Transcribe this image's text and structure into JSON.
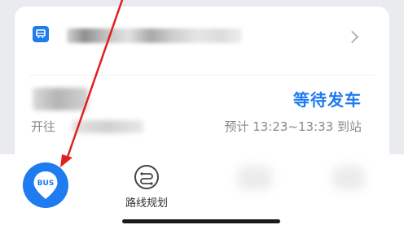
{
  "card": {
    "heading_to": "开往",
    "status": "等待发车",
    "eta": "预计 13:23~13:33 到站"
  },
  "tabbar": {
    "bus_badge": "BUS",
    "route_label": "路线规划"
  },
  "icons": {
    "bus_stop": "bus-stop-icon",
    "chevron": "chevron-right-icon",
    "route": "route-planning-icon"
  },
  "colors": {
    "accent": "#1e7bf0",
    "annotation_arrow": "#e02020",
    "secondary_text": "#8a8a8a"
  }
}
